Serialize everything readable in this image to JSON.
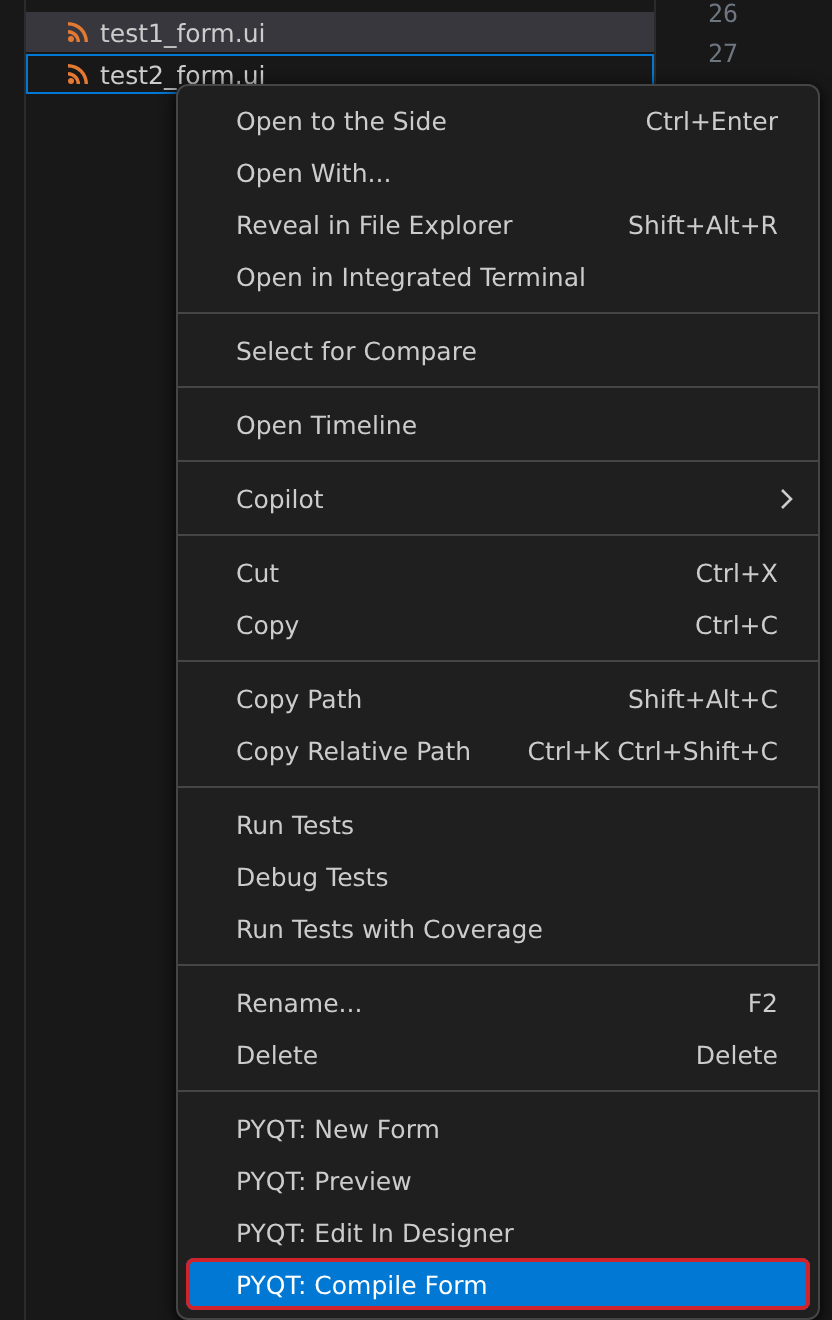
{
  "explorer": {
    "files": [
      {
        "name": "test1_form.ui",
        "selected": true,
        "focused": false
      },
      {
        "name": "test2_form.ui",
        "selected": false,
        "focused": true
      }
    ]
  },
  "editor": {
    "line_numbers": [
      "26",
      "27"
    ]
  },
  "context_menu": {
    "groups": [
      [
        {
          "label": "Open to the Side",
          "shortcut": "Ctrl+Enter",
          "kind": "command",
          "selected": false,
          "annotated": false
        },
        {
          "label": "Open With...",
          "kind": "command",
          "selected": false,
          "annotated": false
        },
        {
          "label": "Reveal in File Explorer",
          "shortcut": "Shift+Alt+R",
          "kind": "command",
          "selected": false,
          "annotated": false
        },
        {
          "label": "Open in Integrated Terminal",
          "kind": "command",
          "selected": false,
          "annotated": false
        }
      ],
      [
        {
          "label": "Select for Compare",
          "kind": "command",
          "selected": false,
          "annotated": false
        }
      ],
      [
        {
          "label": "Open Timeline",
          "kind": "command",
          "selected": false,
          "annotated": false
        }
      ],
      [
        {
          "label": "Copilot",
          "kind": "submenu",
          "selected": false,
          "annotated": false
        }
      ],
      [
        {
          "label": "Cut",
          "shortcut": "Ctrl+X",
          "kind": "command",
          "selected": false,
          "annotated": false
        },
        {
          "label": "Copy",
          "shortcut": "Ctrl+C",
          "kind": "command",
          "selected": false,
          "annotated": false
        }
      ],
      [
        {
          "label": "Copy Path",
          "shortcut": "Shift+Alt+C",
          "kind": "command",
          "selected": false,
          "annotated": false
        },
        {
          "label": "Copy Relative Path",
          "shortcut": "Ctrl+K Ctrl+Shift+C",
          "kind": "command",
          "selected": false,
          "annotated": false
        }
      ],
      [
        {
          "label": "Run Tests",
          "kind": "command",
          "selected": false,
          "annotated": false
        },
        {
          "label": "Debug Tests",
          "kind": "command",
          "selected": false,
          "annotated": false
        },
        {
          "label": "Run Tests with Coverage",
          "kind": "command",
          "selected": false,
          "annotated": false
        }
      ],
      [
        {
          "label": "Rename...",
          "shortcut": "F2",
          "kind": "command",
          "selected": false,
          "annotated": false
        },
        {
          "label": "Delete",
          "shortcut": "Delete",
          "kind": "command",
          "selected": false,
          "annotated": false
        }
      ],
      [
        {
          "label": "PYQT: New Form",
          "kind": "command",
          "selected": false,
          "annotated": false
        },
        {
          "label": "PYQT: Preview",
          "kind": "command",
          "selected": false,
          "annotated": false
        },
        {
          "label": "PYQT: Edit In Designer",
          "kind": "command",
          "selected": false,
          "annotated": false
        },
        {
          "label": "PYQT: Compile Form",
          "kind": "command",
          "selected": true,
          "annotated": true
        }
      ]
    ]
  }
}
